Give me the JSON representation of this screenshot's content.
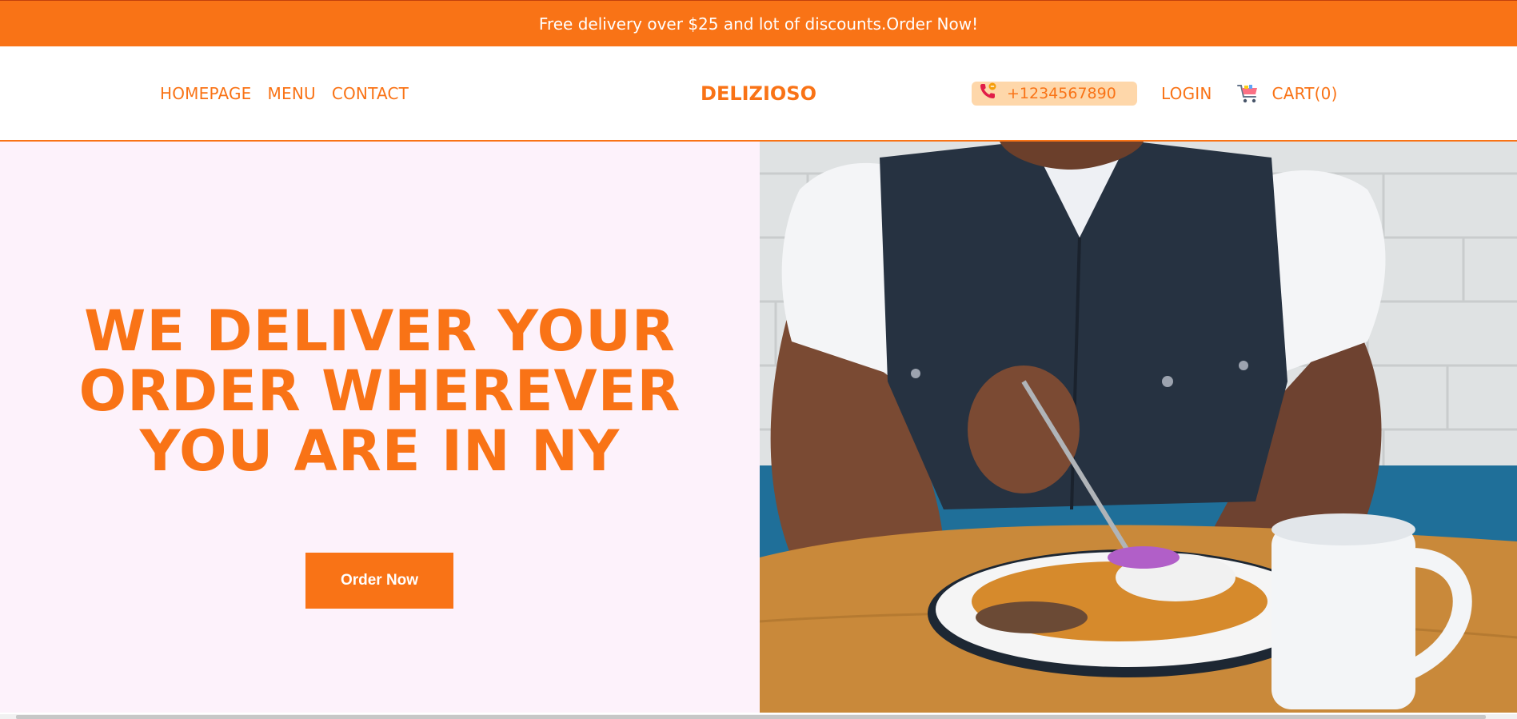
{
  "promo": {
    "text": "Free delivery over $25 and lot of discounts.Order Now!"
  },
  "nav": {
    "links": [
      {
        "label": "HOMEPAGE"
      },
      {
        "label": "MENU"
      },
      {
        "label": "CONTACT"
      }
    ],
    "brand": "DELIZIOSO",
    "phone": "+1234567890",
    "login": "LOGIN",
    "cart": "CART(0)"
  },
  "hero": {
    "headline_lines": [
      "WE DELIVER YOUR",
      "ORDER WHEREVER",
      "YOU ARE IN NY"
    ],
    "cta": "Order Now"
  },
  "colors": {
    "accent": "#f97316",
    "hero_bg": "#fdf2fb",
    "phone_pill": "#fed7aa"
  },
  "icons": {
    "phone": "phone-call-icon",
    "cart": "shopping-cart-icon"
  }
}
